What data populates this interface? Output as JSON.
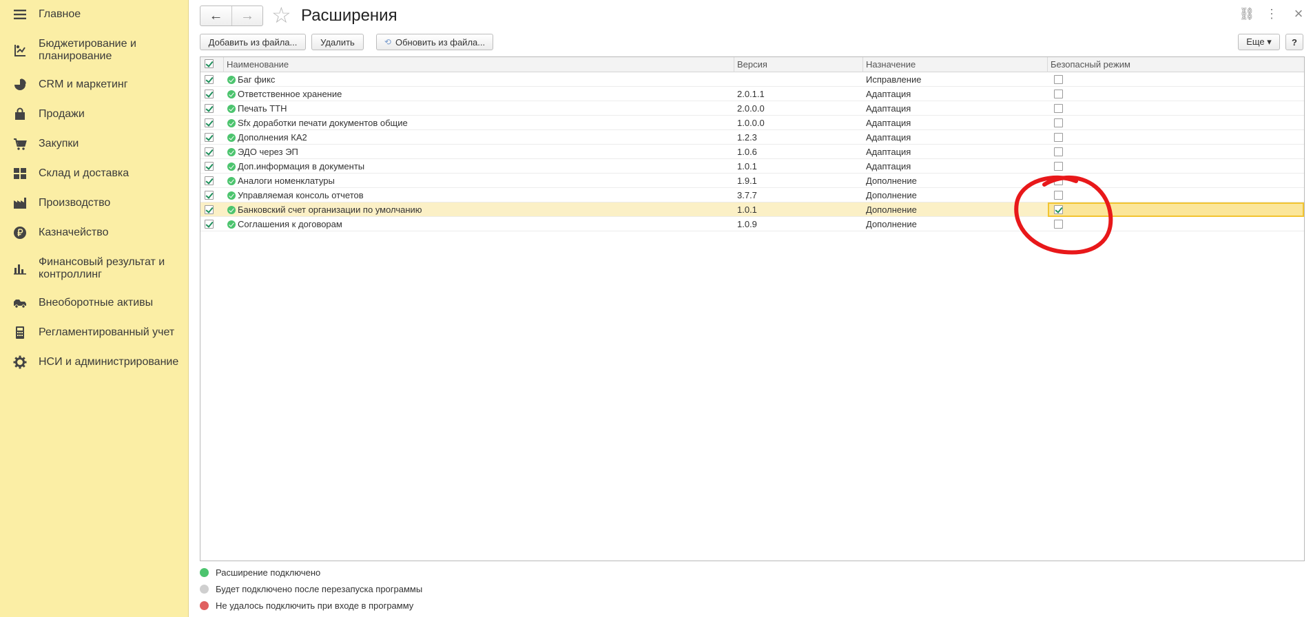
{
  "sidebar": {
    "items": [
      {
        "label": "Главное",
        "icon": "menu-icon"
      },
      {
        "label": "Бюджетирование и планирование",
        "icon": "budget-icon"
      },
      {
        "label": "CRM и маркетинг",
        "icon": "pie-chart-icon"
      },
      {
        "label": "Продажи",
        "icon": "shopping-bag-icon"
      },
      {
        "label": "Закупки",
        "icon": "cart-icon"
      },
      {
        "label": "Склад и доставка",
        "icon": "warehouse-grid-icon"
      },
      {
        "label": "Производство",
        "icon": "factory-icon"
      },
      {
        "label": "Казначейство",
        "icon": "ruble-coin-icon"
      },
      {
        "label": "Финансовый результат и контроллинг",
        "icon": "bar-chart-icon"
      },
      {
        "label": "Внеоборотные активы",
        "icon": "truck-icon"
      },
      {
        "label": "Регламентированный учет",
        "icon": "calculator-icon"
      },
      {
        "label": "НСИ и администрирование",
        "icon": "gear-icon"
      }
    ]
  },
  "header": {
    "back": "←",
    "forward": "→",
    "star": "☆",
    "title": "Расширения",
    "link_icon": "⛓",
    "more_icon": "⋮",
    "close_icon": "×"
  },
  "toolbar": {
    "add_from_file": "Добавить из файла...",
    "delete": "Удалить",
    "update_from_file": "Обновить из файла...",
    "more": "Еще ▾",
    "help": "?"
  },
  "table": {
    "columns": [
      "Наименование",
      "Версия",
      "Назначение",
      "Безопасный режим"
    ],
    "rows": [
      {
        "name": "Баг фикс",
        "version": "",
        "purpose": "Исправление",
        "enabled": true,
        "safe": false
      },
      {
        "name": "Ответственное хранение",
        "version": "2.0.1.1",
        "purpose": "Адаптация",
        "enabled": true,
        "safe": false
      },
      {
        "name": "Печать ТТН",
        "version": "2.0.0.0",
        "purpose": "Адаптация",
        "enabled": true,
        "safe": false
      },
      {
        "name": "Sfx доработки печати документов общие",
        "version": "1.0.0.0",
        "purpose": "Адаптация",
        "enabled": true,
        "safe": false
      },
      {
        "name": "Дополнения КА2",
        "version": "1.2.3",
        "purpose": "Адаптация",
        "enabled": true,
        "safe": false
      },
      {
        "name": "ЭДО через ЭП",
        "version": "1.0.6",
        "purpose": "Адаптация",
        "enabled": true,
        "safe": false
      },
      {
        "name": "Доп.информация в документы",
        "version": "1.0.1",
        "purpose": "Адаптация",
        "enabled": true,
        "safe": false
      },
      {
        "name": "Аналоги номенклатуры",
        "version": "1.9.1",
        "purpose": "Дополнение",
        "enabled": true,
        "safe": false
      },
      {
        "name": "Управляемая консоль отчетов",
        "version": "3.7.7",
        "purpose": "Дополнение",
        "enabled": true,
        "safe": false
      },
      {
        "name": "Банковский счет организации по умолчанию",
        "version": "1.0.1",
        "purpose": "Дополнение",
        "enabled": true,
        "safe": true,
        "selected": true
      },
      {
        "name": "Соглашения к договорам",
        "version": "1.0.9",
        "purpose": "Дополнение",
        "enabled": true,
        "safe": false
      }
    ]
  },
  "legend": [
    {
      "text": "Расширение подключено",
      "color": "#4cc46e"
    },
    {
      "text": "Будет подключено после перезапуска программы",
      "color": "#cfcfcf"
    },
    {
      "text": "Не удалось подключить при входе в программу",
      "color": "#e06060"
    }
  ],
  "colors": {
    "sidebar_bg": "#fbeea5",
    "selection": "#fbf0c6",
    "focus": "#f2c430",
    "annotation": "#e8181a"
  }
}
